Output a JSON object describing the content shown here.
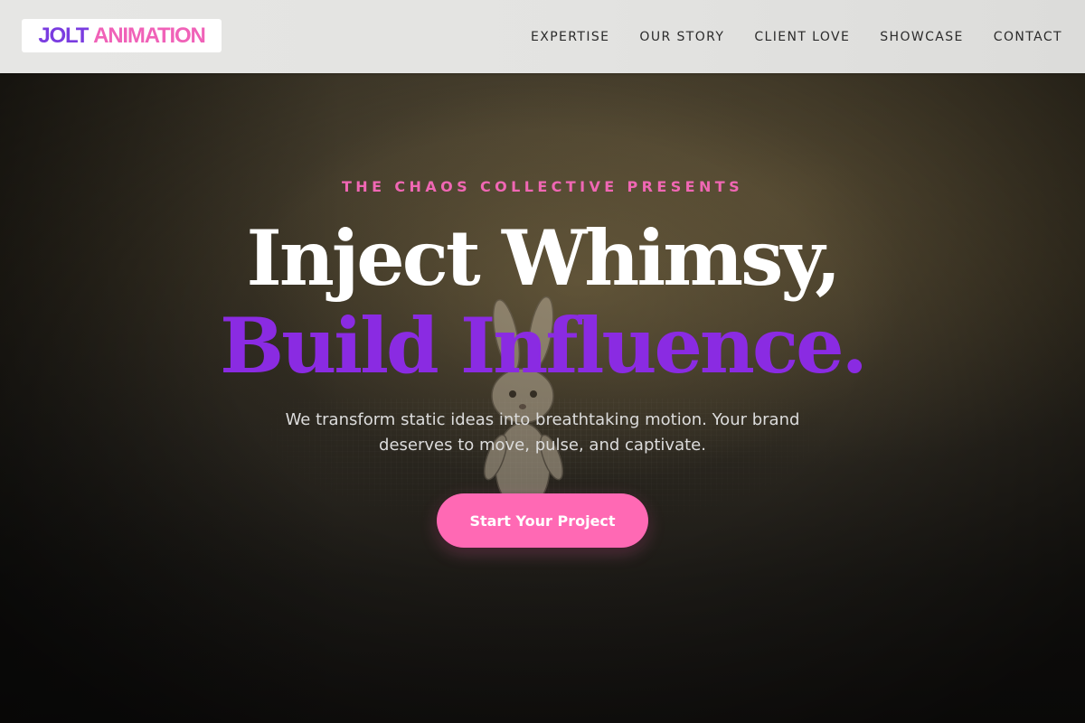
{
  "brand": {
    "word1": "JOLT",
    "word2": "ANIMATION"
  },
  "nav": {
    "items": [
      {
        "label": "EXPERTISE"
      },
      {
        "label": "OUR STORY"
      },
      {
        "label": "CLIENT LOVE"
      },
      {
        "label": "SHOWCASE"
      },
      {
        "label": "CONTACT"
      }
    ]
  },
  "hero": {
    "eyebrow": "THE CHAOS COLLECTIVE PRESENTS",
    "headline_line1": "Inject Whimsy,",
    "headline_line2": "Build Influence.",
    "subcopy": "We transform static ideas into breathtaking motion. Your brand deserves to move, pulse, and captivate.",
    "cta_label": "Start Your Project",
    "background_image": "dark-room-toy-bunny-photo"
  },
  "colors": {
    "accent_purple": "#8a2be2",
    "accent_pink": "#ff69b4",
    "header_bg": "#e4e4e2"
  }
}
